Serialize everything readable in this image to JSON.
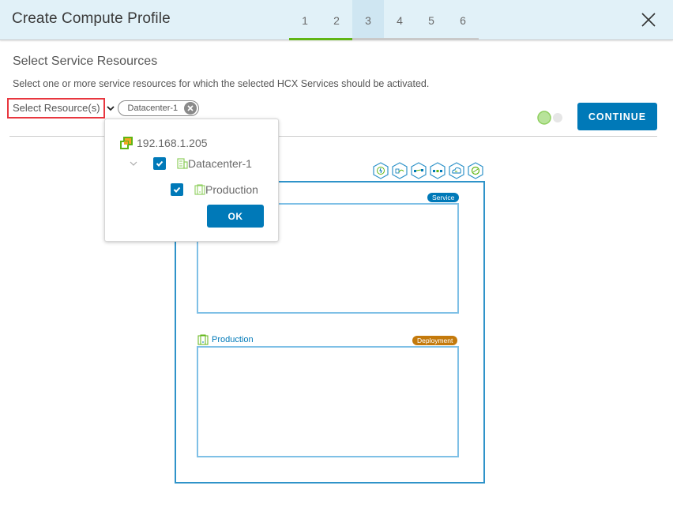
{
  "header": {
    "title": "Create Compute Profile",
    "steps": [
      {
        "label": "1",
        "state": "done"
      },
      {
        "label": "2",
        "state": "done"
      },
      {
        "label": "3",
        "state": "active"
      },
      {
        "label": "4",
        "state": "pending"
      },
      {
        "label": "5",
        "state": "pending"
      },
      {
        "label": "6",
        "state": "pending"
      }
    ],
    "close_icon": "close-icon"
  },
  "section": {
    "title": "Select Service Resources",
    "description": "Select one or more service resources for which the selected HCX Services should be activated."
  },
  "resource_selector": {
    "label": "Select Resource(s)",
    "selected_chips": [
      "Datacenter-1"
    ]
  },
  "actions": {
    "continue_label": "CONTINUE",
    "toggle_state": "on"
  },
  "popover": {
    "tree": {
      "host": {
        "label": "192.168.1.205",
        "icon": "vcenter-icon"
      },
      "datacenter": {
        "label": "Datacenter-1",
        "checked": true,
        "expanded": true,
        "icon": "datacenter-icon"
      },
      "cluster": {
        "label": "Production",
        "checked": true,
        "icon": "cluster-icon"
      }
    },
    "ok_label": "OK"
  },
  "topology": {
    "service_icons": [
      "interconnect-icon",
      "wan-optimization-icon",
      "network-extension-icon",
      "bulk-migration-icon",
      "cloud-migration-icon",
      "disaster-recovery-icon"
    ],
    "service_badge": "Service",
    "deployment_cluster": "Production",
    "deployment_badge": "Deployment"
  },
  "colors": {
    "accent": "#0079b8",
    "success": "#60b515",
    "header_bg": "#e1f1f8",
    "deployment_badge": "#c47a0c",
    "highlight": "#e8373f"
  }
}
